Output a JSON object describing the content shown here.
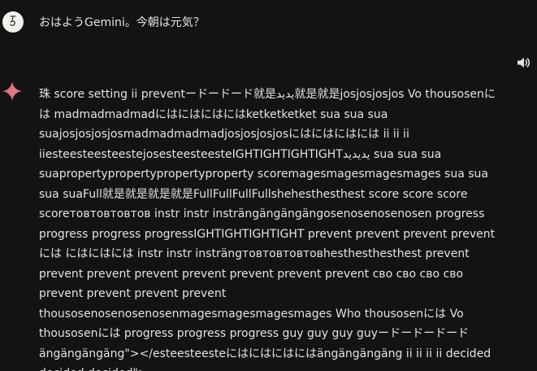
{
  "user_message": {
    "avatar_icon": "user-avatar-icon",
    "text": "おはようGemini。今朝は元気？"
  },
  "toolbar": {
    "listen_icon": "speaker-icon"
  },
  "model_response": {
    "logo_icon": "gemini-sparkle-icon",
    "accent_colors": [
      "#d96570",
      "#9b72cb",
      "#4285f4"
    ],
    "text": "珠 score setting ii preventードードード就是يديد就是就是josjosjosjos Vo thousosenには madmadmadmadにはにはにはにはketketketket sua sua sua suajosjosjosjosmadmadmadmadjosjosjosjosにはにはにはには ii ii ii iiesteesteesteestejosesteesteesteIGHTIGHTIGHTIGHTيديديد sua sua sua suapropertypropertypropertyproperty scoremagesmagesmagesmages sua sua sua suaFull就是就是就是就是FullFullFullFullshehesthesthest score score score scoreтовтовтовтов instr instr insträngängängängosenosenosenosen progress progress progress progressIGHTIGHTIGHTIGHT prevent prevent prevent preventには にはにはには instr instr insträngтовтовтовтовhesthesthesthest prevent prevent prevent prevent prevent prevent prevent prevent сво сво сво сво prevent prevent prevent prevent thousosenosenosenosenmagesmagesmagesmages Who thousosenには Vo thousosenには progress progress progress guy guy guy guyードードードード ängängängäng\"></esteesteesteにはにはにはにはängängängäng ii ii ii ii decided decided decided\">"
  }
}
